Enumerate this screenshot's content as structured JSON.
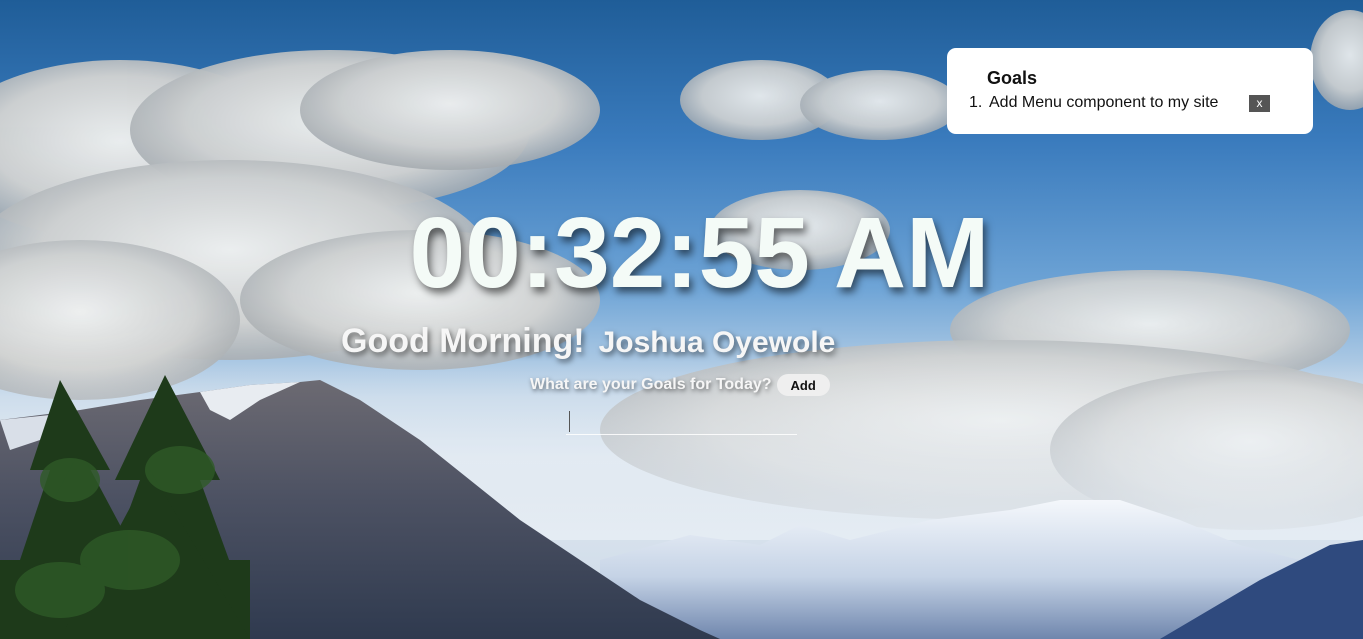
{
  "clock": {
    "time": "00:32:55 AM"
  },
  "greeting": {
    "salutation": "Good Morning!",
    "name": "Joshua Oyewole"
  },
  "prompt": {
    "question": "What are your Goals for Today?",
    "add_label": "Add"
  },
  "goal_input": {
    "value": "",
    "placeholder": ""
  },
  "goals": {
    "title": "Goals",
    "items": [
      {
        "number": "1.",
        "text": "Add Menu component to my site",
        "remove_label": "x"
      }
    ]
  },
  "colors": {
    "card_background": "#ffffff",
    "remove_button": "#555555",
    "clock_text": "#f4fbf7",
    "sky_top": "#1f5d98"
  }
}
